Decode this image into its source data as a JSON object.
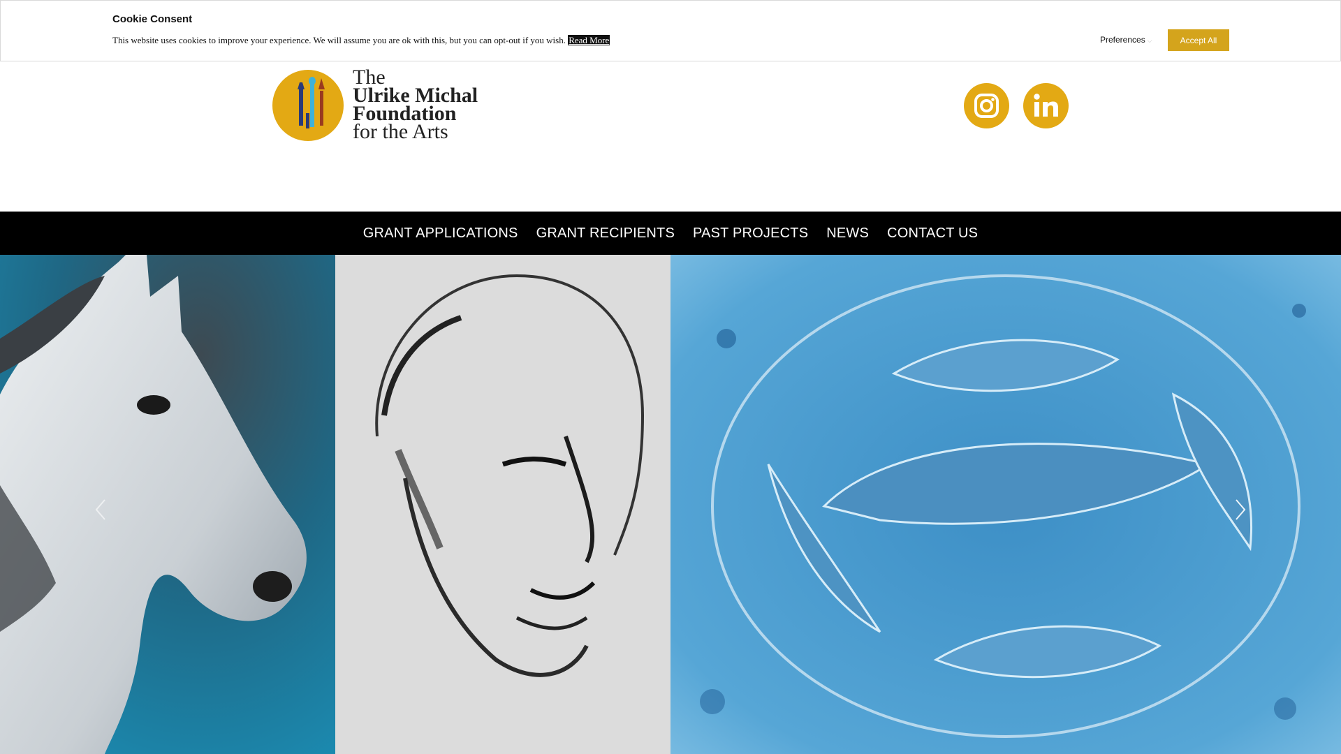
{
  "cookie": {
    "title": "Cookie Consent",
    "message": "This website uses cookies to improve your experience. We will assume you are ok with this, but you can opt-out if you wish.",
    "read_more": "Read More",
    "preferences": "Preferences",
    "accept_all": "Accept All",
    "accent_color": "#d4a41c"
  },
  "logo": {
    "line1": "The",
    "line2a": "Ulrike Michal",
    "line2b": "Foundation",
    "line3": "for the Arts",
    "brand_color": "#e3a914"
  },
  "social": [
    {
      "name": "instagram",
      "icon": "instagram-icon"
    },
    {
      "name": "linkedin",
      "icon": "linkedin-icon"
    }
  ],
  "nav": {
    "items": [
      "GRANT APPLICATIONS",
      "GRANT RECIPIENTS",
      "PAST PROJECTS",
      "NEWS",
      "CONTACT US"
    ]
  },
  "slider": {
    "slides": [
      "horse painting",
      "charcoal head sketch",
      "dolphins watercolor"
    ],
    "prev_icon": "chevron-left-icon",
    "next_icon": "chevron-right-icon"
  }
}
